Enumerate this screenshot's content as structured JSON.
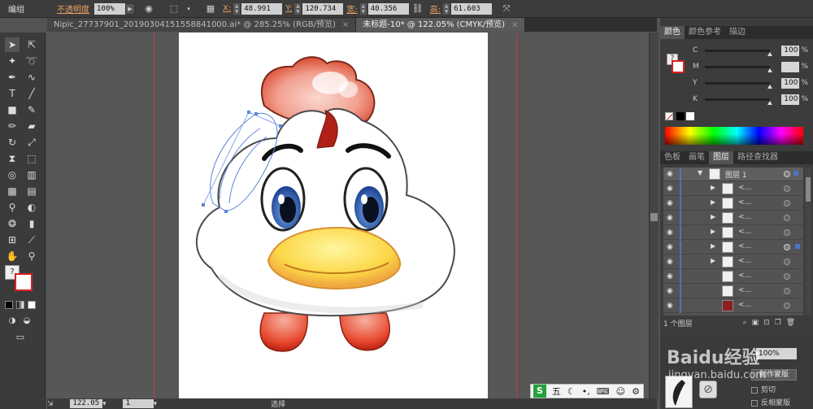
{
  "control_bar": {
    "object_label": "编组",
    "opacity_label": "不透明度",
    "opacity_value": "100%",
    "x_label": "X:",
    "x_value": "48.991 mm",
    "y_label": "Y:",
    "y_value": "120.734 m",
    "width_label": "宽:",
    "width_value": "40.356 mm",
    "height_label": "高:",
    "height_value": "61.603 mm"
  },
  "tabs": [
    {
      "label": "Nipic_27737901_20190304151558841000.ai* @ 285.25% (RGB/预览)",
      "close": "×"
    },
    {
      "label": "未标题-10* @ 122.05% (CMYK/预览)",
      "close": "×"
    }
  ],
  "color_panel": {
    "tabs": [
      "颜色",
      "颜色参考",
      "描边"
    ],
    "channels": [
      {
        "name": "C",
        "value": "100",
        "unit": "%"
      },
      {
        "name": "M",
        "value": "100",
        "unit": "%"
      },
      {
        "name": "Y",
        "value": "100",
        "unit": "%"
      },
      {
        "name": "K",
        "value": "100",
        "unit": "%"
      }
    ],
    "colors": {
      "fill": "#3a1a1a",
      "stroke_accent": "#d82020"
    }
  },
  "layers_panel": {
    "tabs": [
      "色板",
      "画笔",
      "图层",
      "路径查找器"
    ],
    "top_layer": "图层 1",
    "rows": [
      {
        "name": "<...",
        "expand": "▶"
      },
      {
        "name": "<...",
        "expand": "▶"
      },
      {
        "name": "<...",
        "expand": "▶"
      },
      {
        "name": "<...",
        "expand": "▶"
      },
      {
        "name": "<...",
        "expand": "▶"
      },
      {
        "name": "<...",
        "expand": "▶"
      },
      {
        "name": "<...",
        "expand": ""
      },
      {
        "name": "<...",
        "expand": ""
      },
      {
        "name": "<...",
        "expand": ""
      },
      {
        "name": "<...",
        "expand": ""
      }
    ],
    "footer": "1 个图层"
  },
  "transparency_panel": {
    "opacity": "100%",
    "make_mask": "制作蒙版",
    "clip": "剪切",
    "invert_mask": "反相蒙版",
    "watermark_1": "Baidu经验",
    "watermark_2": "jingyan.baidu.com"
  },
  "status_bar": {
    "zoom": "122.05",
    "page": "1",
    "tool": "选择"
  },
  "ime": {
    "logo": "S",
    "mode": "五"
  }
}
